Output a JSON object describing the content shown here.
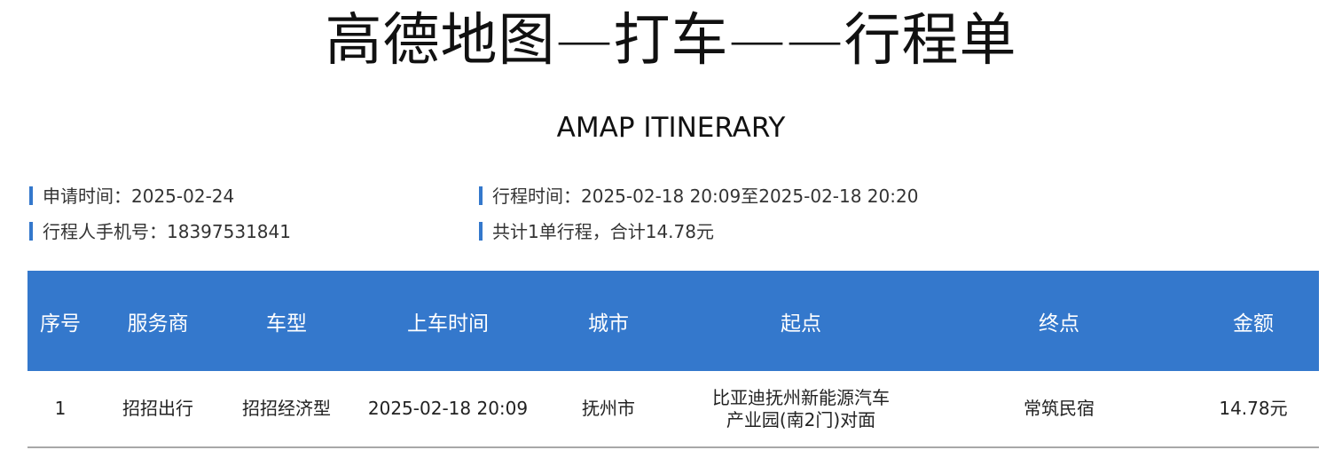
{
  "header": {
    "title": "高德地图—打车——行程单",
    "subtitle": "AMAP ITINERARY"
  },
  "info": {
    "apply_time": "申请时间：2025-02-24",
    "trip_time": "行程时间：2025-02-18 20:09至2025-02-18 20:20",
    "phone": "行程人手机号：18397531841",
    "total": "共计1单行程，合计14.78元"
  },
  "table": {
    "headers": [
      "序号",
      "服务商",
      "车型",
      "上车时间",
      "城市",
      "起点",
      "终点",
      "金额"
    ],
    "rows": [
      {
        "index": "1",
        "provider": "招招出行",
        "car_type": "招招经济型",
        "pickup_time": "2025-02-18 20:09",
        "city": "抚州市",
        "start": "比亚迪抚州新能源汽车产业园(南2门)对面",
        "end": "常筑民宿",
        "amount": "14.78元"
      }
    ]
  },
  "colors": {
    "accent": "#3478cc",
    "border": "#a8a8a8",
    "header_text": "#ffffff"
  }
}
